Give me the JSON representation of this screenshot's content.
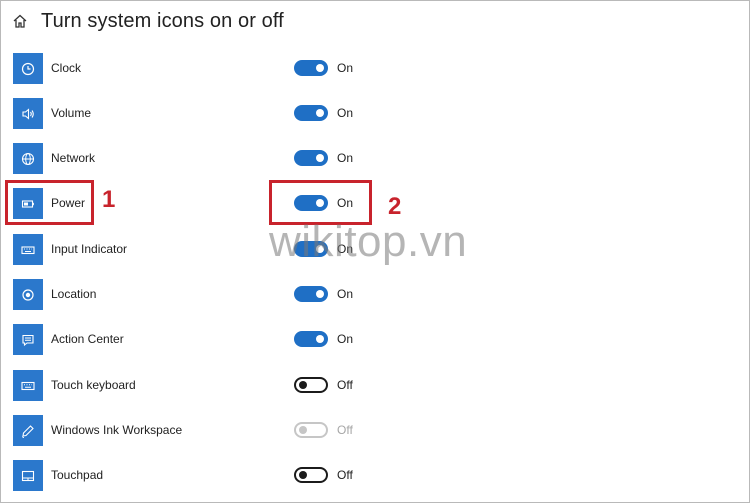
{
  "header": {
    "title": "Turn system icons on or off"
  },
  "items": [
    {
      "label": "Clock",
      "icon": "clock-icon",
      "state": "on",
      "state_label": "On"
    },
    {
      "label": "Volume",
      "icon": "volume-icon",
      "state": "on",
      "state_label": "On"
    },
    {
      "label": "Network",
      "icon": "network-icon",
      "state": "on",
      "state_label": "On"
    },
    {
      "label": "Power",
      "icon": "battery-icon",
      "state": "on",
      "state_label": "On"
    },
    {
      "label": "Input Indicator",
      "icon": "keyboard-icon",
      "state": "on",
      "state_label": "On"
    },
    {
      "label": "Location",
      "icon": "location-icon",
      "state": "on",
      "state_label": "On"
    },
    {
      "label": "Action Center",
      "icon": "action-center-icon",
      "state": "on",
      "state_label": "On"
    },
    {
      "label": "Touch keyboard",
      "icon": "touch-keyboard-icon",
      "state": "off",
      "state_label": "Off"
    },
    {
      "label": "Windows Ink Workspace",
      "icon": "pen-icon",
      "state": "disabled",
      "state_label": "Off"
    },
    {
      "label": "Touchpad",
      "icon": "touchpad-icon",
      "state": "off",
      "state_label": "Off"
    }
  ],
  "annotations": {
    "marker_1": "1",
    "marker_2": "2",
    "color": "#c8232c"
  },
  "watermark": "wikitop.vn",
  "colors": {
    "tile": "#2b78cc",
    "toggle_on": "#1f6fc5"
  }
}
